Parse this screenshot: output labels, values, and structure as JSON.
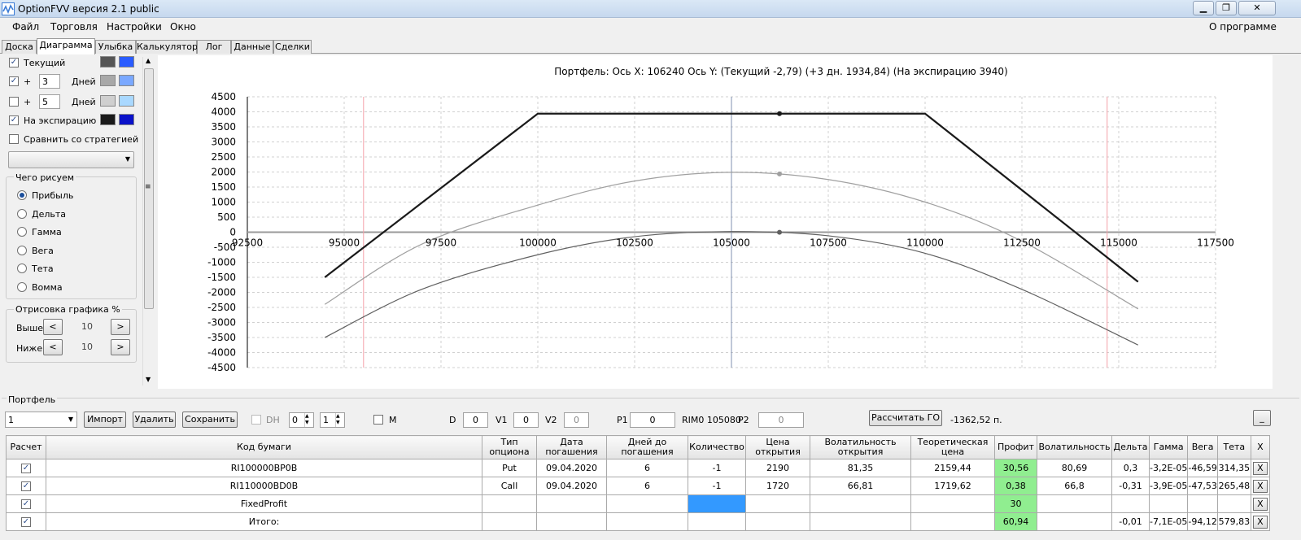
{
  "window": {
    "title": "OptionFVV версия 2.1 public"
  },
  "menu": {
    "items": [
      "Файл",
      "Торговля",
      "Настройки",
      "Окно"
    ],
    "about": "О программе"
  },
  "tabs": [
    "Доска",
    "Диаграмма",
    "Улыбка",
    "Калькулятор",
    "Лог",
    "Данные",
    "Сделки"
  ],
  "active_tab": "Диаграмма",
  "left_panel": {
    "current": {
      "label": "Текущий",
      "checked": true
    },
    "plus_days_1": {
      "plus": "+",
      "value": "3",
      "unit": "Дней",
      "checked": true
    },
    "plus_days_2": {
      "plus": "+",
      "value": "5",
      "unit": "Дней",
      "checked": false
    },
    "expiration": {
      "label": "На экспирацию",
      "checked": true
    },
    "compare": {
      "label": "Сравнить со стратегией",
      "checked": false
    },
    "draw_group": {
      "title": "Чего рисуем",
      "options": [
        "Прибыль",
        "Дельта",
        "Гамма",
        "Вега",
        "Тета",
        "Вомма"
      ],
      "selected": "Прибыль"
    },
    "percent_group": {
      "title": "Отрисовка графика %",
      "above_label": "Выше",
      "above_value": "10",
      "below_label": "Ниже",
      "below_value": "10",
      "dec": "<",
      "inc": ">"
    }
  },
  "chart_data": {
    "type": "line",
    "title": "Портфель: Ось X: 106240 Ось Y:  (Текущий -2,79)  (+3 дн. 1934,84)  (На экспирацию 3940)",
    "xlim": [
      92500,
      117500
    ],
    "ylim": [
      -4500,
      4500
    ],
    "x_ticks": [
      "92500",
      "95000",
      "97500",
      "100000",
      "102500",
      "105000",
      "107500",
      "110000",
      "112500",
      "115000",
      "117500"
    ],
    "y_ticks": [
      "4500",
      "4000",
      "3500",
      "3000",
      "2500",
      "2000",
      "1500",
      "1000",
      "500",
      "0",
      "-500",
      "-1000",
      "-1500",
      "-2000",
      "-2500",
      "-3000",
      "-3500",
      "-4000",
      "-4500"
    ],
    "grid": true,
    "current_x": 105000,
    "cursor_x": 106240,
    "red_lines": [
      95500,
      114700
    ],
    "series": [
      {
        "name": "На экспирацию",
        "color": "#1a1a1a",
        "x": [
          94500,
          100000,
          110000,
          115500
        ],
        "y": [
          -1500,
          3940,
          3940,
          -1650
        ]
      },
      {
        "name": "+3 дн.",
        "color": "#a0a0a0",
        "x": [
          94500,
          97000,
          100000,
          102500,
          105000,
          107500,
          110000,
          112500,
          115500
        ],
        "y": [
          -2400,
          -400,
          900,
          1700,
          1990,
          1750,
          1000,
          -300,
          -2550
        ]
      },
      {
        "name": "Текущий",
        "color": "#606060",
        "x": [
          94500,
          97000,
          100000,
          102500,
          105000,
          107500,
          110000,
          112500,
          115500
        ],
        "y": [
          -3500,
          -1900,
          -750,
          -150,
          20,
          -120,
          -700,
          -1900,
          -3750
        ]
      }
    ],
    "markers": [
      {
        "x": 106240,
        "y": 3940,
        "color": "#1a1a1a"
      },
      {
        "x": 106240,
        "y": 1935,
        "color": "#a0a0a0"
      },
      {
        "x": 106240,
        "y": -3,
        "color": "#606060"
      }
    ]
  },
  "portfolio": {
    "title": "Портфель",
    "selector": "1",
    "buttons": {
      "import": "Импорт",
      "delete": "Удалить",
      "save": "Сохранить",
      "calc": "Рассчитать ГО",
      "min": "_"
    },
    "dh_label": "DH",
    "dh_spin1": "0",
    "dh_spin2": "1",
    "m_label": "M",
    "d_label": "D",
    "d_value": "0",
    "v1_label": "V1",
    "v1_value": "0",
    "v2_label": "V2",
    "v2_value": "0",
    "p1_label": "P1",
    "p1_value": "0",
    "rim_label": "RIM0 105080",
    "p2_label": "P2",
    "p2_value": "0",
    "go_value": "-1362,52 п."
  },
  "grid": {
    "headers": [
      "Расчет",
      "Код бумаги",
      "Тип опциона",
      "Дата погашения",
      "Дней до погашения",
      "Количество",
      "Цена открытия",
      "Волатильность открытия",
      "Теоретическая цена",
      "Профит",
      "Волатильность",
      "Дельта",
      "Гамма",
      "Вега",
      "Тета",
      "X"
    ],
    "rows": [
      [
        "✓",
        "RI100000BP0B",
        "Put",
        "09.04.2020",
        "6",
        "-1",
        "2190",
        "81,35",
        "2159,44",
        "30,56",
        "80,69",
        "0,3",
        "-3,2E-05",
        "-46,59",
        "314,35",
        "X"
      ],
      [
        "✓",
        "RI110000BD0B",
        "Call",
        "09.04.2020",
        "6",
        "-1",
        "1720",
        "66,81",
        "1719,62",
        "0,38",
        "66,8",
        "-0,31",
        "-3,9E-05",
        "-47,53",
        "265,48",
        "X"
      ],
      [
        "✓",
        "FixedProfit",
        "",
        "",
        "",
        "",
        "",
        "",
        "",
        "30",
        "",
        "",
        "",
        "",
        "",
        "X"
      ],
      [
        "✓",
        "Итого:",
        "",
        "",
        "",
        "",
        "",
        "",
        "",
        "60,94",
        "",
        "-0,01",
        "-7,1E-05",
        "-94,12",
        "579,83",
        "X"
      ]
    ]
  }
}
